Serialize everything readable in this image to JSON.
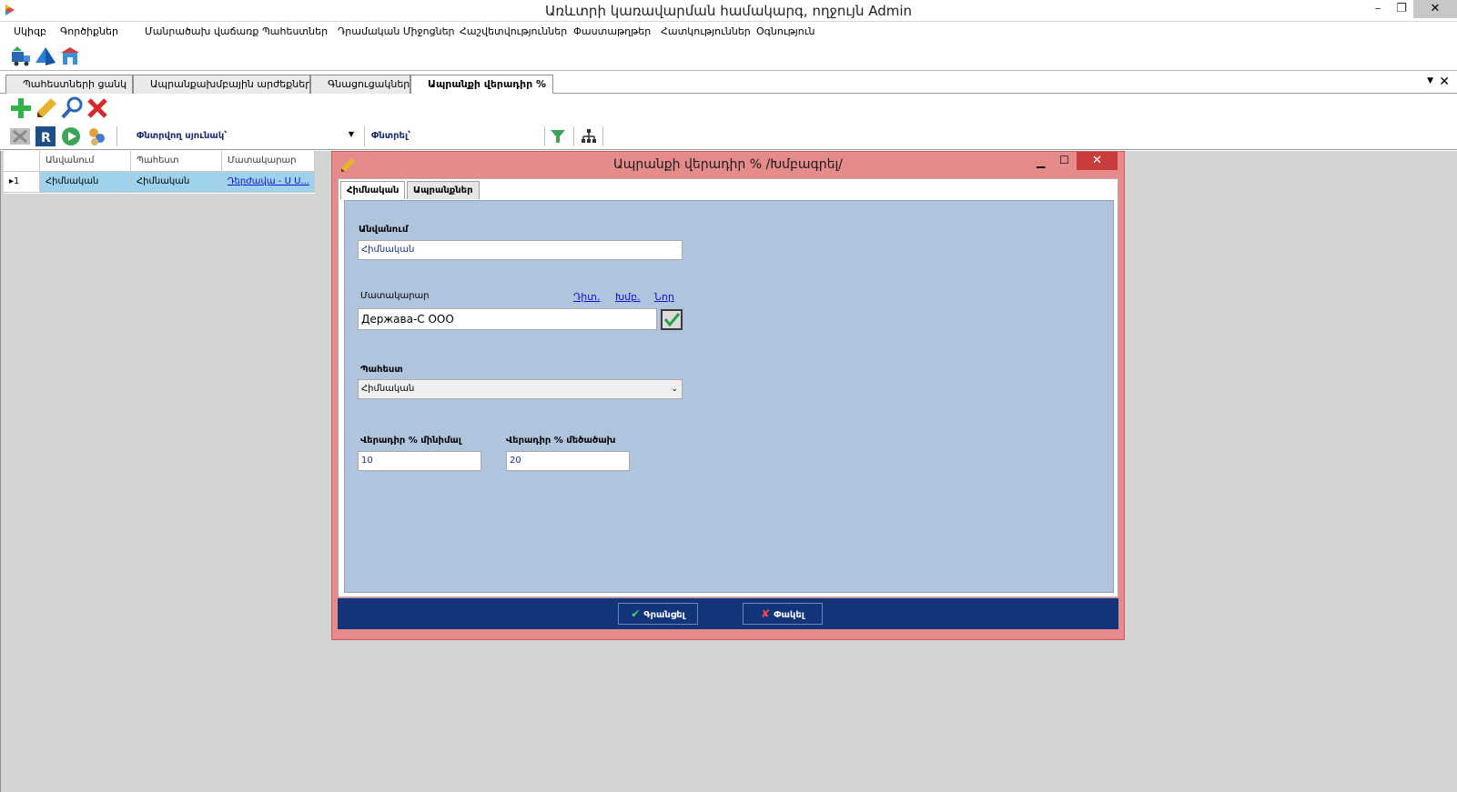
{
  "window": {
    "title": "Առևտրի կառավարման համակարգ, ողջույն Admin",
    "min": "–",
    "restore": "❐",
    "close": "✕"
  },
  "menu": [
    "Սկիզբ",
    "Գործիքներ",
    "Մանրածախ վաճառք",
    "Պահեստներ",
    "Դրամական Միջոցներ",
    "Հաշվետվություններ",
    "Փաստաթղթեր",
    "Հատկություններ",
    "Օգնություն"
  ],
  "tabs": [
    {
      "label": "Պահեստների ցանկ"
    },
    {
      "label": "Ապրանքախմբային արժեքներ..."
    },
    {
      "label": "Գնացուցակներ"
    },
    {
      "label": "Ապրանքի վերադիր %"
    }
  ],
  "toolbar3": {
    "sort_label": "Փնտրվող սյունակ՝",
    "search_label": "Փնտրել՝",
    "sort_value": "",
    "search_value": ""
  },
  "grid": {
    "columns": [
      "Անվանում",
      "Պահեստ",
      "Մատակարար"
    ],
    "rows": [
      {
        "marker": "▸1",
        "cells": [
          "Հիմնական",
          "Հիմնական",
          "Դերժավա - Ս Ս..."
        ]
      }
    ]
  },
  "dialog": {
    "title": "Ապրանքի վերադիր % /Խմբագրել/",
    "tabs": [
      "Հիմնական",
      "Ապրանքներ"
    ],
    "name_label": "Անվանում",
    "name_value": "Հիմնական",
    "supplier_label": "Մատակարար",
    "supplier_links": [
      "Դիտ.",
      "Խմբ.",
      "Նոր"
    ],
    "supplier_value": "Держава-С ООО",
    "warehouse_label": "Պահեստ",
    "warehouse_value": "Հիմնական",
    "markup_min_label": "Վերադիր % մինիմալ",
    "markup_min_value": "10",
    "markup_max_label": "Վերադիր % մեծածախ",
    "markup_max_value": "20",
    "save_label": "Գրանցել",
    "close_label": "Փակել"
  },
  "colors": {
    "dialog_frame": "#e68b8b",
    "panel": "#b0c4de",
    "footer": "#12347a",
    "selected_row": "#9ed2ec"
  }
}
